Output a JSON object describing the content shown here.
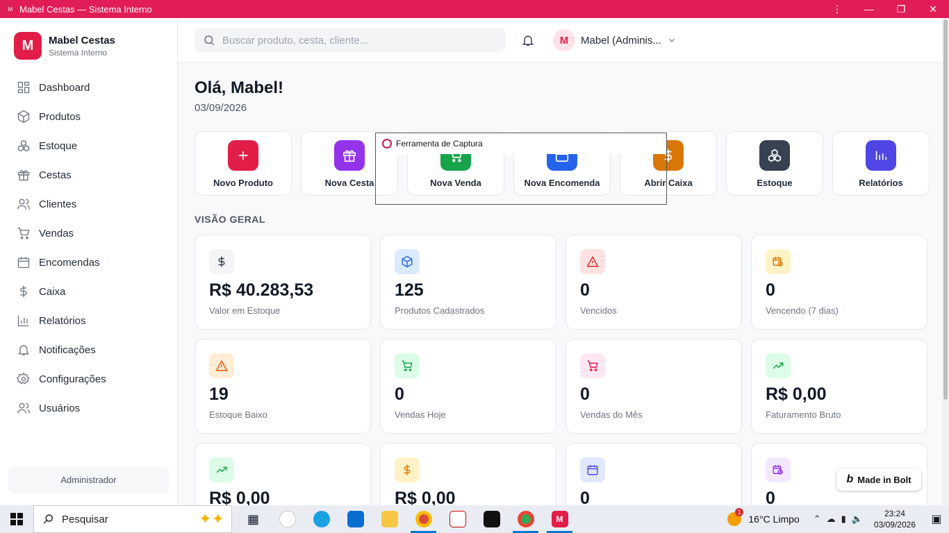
{
  "window": {
    "title": "Mabel Cestas — Sistema Interno",
    "app_icon_text": "M"
  },
  "brand": {
    "logo_letter": "M",
    "name": "Mabel Cestas",
    "subtitle": "Sistema Interno"
  },
  "sidebar": {
    "items": [
      {
        "label": "Dashboard",
        "icon": "grid-icon"
      },
      {
        "label": "Produtos",
        "icon": "box-icon"
      },
      {
        "label": "Estoque",
        "icon": "boxes-icon"
      },
      {
        "label": "Cestas",
        "icon": "gift-icon"
      },
      {
        "label": "Clientes",
        "icon": "users-icon"
      },
      {
        "label": "Vendas",
        "icon": "cart-icon"
      },
      {
        "label": "Encomendas",
        "icon": "calendar-icon"
      },
      {
        "label": "Caixa",
        "icon": "dollar-icon"
      },
      {
        "label": "Relatórios",
        "icon": "bar-chart-icon"
      },
      {
        "label": "Notificações",
        "icon": "bell-icon"
      },
      {
        "label": "Configurações",
        "icon": "gear-icon"
      },
      {
        "label": "Usuários",
        "icon": "user-group-icon"
      }
    ],
    "role": "Administrador"
  },
  "header": {
    "search_placeholder": "Buscar produto, cesta, cliente...",
    "user_initial": "M",
    "user_name": "Mabel (Adminis..."
  },
  "main": {
    "greeting": "Olá, Mabel!",
    "date": "03/09/2026",
    "quick_actions": [
      {
        "label": "Novo Produto",
        "color": "#e11d48",
        "icon": "plus-icon"
      },
      {
        "label": "Nova Cesta",
        "color": "#9333ea",
        "icon": "gift-icon"
      },
      {
        "label": "Nova Venda",
        "color": "#16a34a",
        "icon": "cart-icon"
      },
      {
        "label": "Nova Encomenda",
        "color": "#2563eb",
        "icon": "calendar-icon"
      },
      {
        "label": "Abrir Caixa",
        "color": "#d97706",
        "icon": "dollar-icon"
      },
      {
        "label": "Estoque",
        "color": "#374151",
        "icon": "boxes-icon"
      },
      {
        "label": "Relatórios",
        "color": "#4f46e5",
        "icon": "bar-chart-icon"
      }
    ],
    "section_title": "VISÃO GERAL",
    "stats": [
      {
        "value": "R$ 40.283,53",
        "label": "Valor em Estoque",
        "icon": "dollar-icon",
        "bg": "#f3f4f6",
        "fg": "#374151"
      },
      {
        "value": "125",
        "label": "Produtos Cadastrados",
        "icon": "box-icon",
        "bg": "#dbeafe",
        "fg": "#2563eb"
      },
      {
        "value": "0",
        "label": "Vencidos",
        "icon": "alert-icon",
        "bg": "#fee2e2",
        "fg": "#dc2626"
      },
      {
        "value": "0",
        "label": "Vencendo (7 dias)",
        "icon": "calendar-clock-icon",
        "bg": "#fef3c7",
        "fg": "#d97706"
      },
      {
        "value": "19",
        "label": "Estoque Baixo",
        "icon": "alert-icon",
        "bg": "#ffedd5",
        "fg": "#ea580c"
      },
      {
        "value": "0",
        "label": "Vendas Hoje",
        "icon": "cart-icon",
        "bg": "#dcfce7",
        "fg": "#16a34a"
      },
      {
        "value": "0",
        "label": "Vendas do Mês",
        "icon": "cart-icon",
        "bg": "#fce7f3",
        "fg": "#e11d48"
      },
      {
        "value": "R$ 0,00",
        "label": "Faturamento Bruto",
        "icon": "trend-up-icon",
        "bg": "#dcfce7",
        "fg": "#16a34a"
      },
      {
        "value": "R$ 0,00",
        "label": "",
        "icon": "trend-up-icon",
        "bg": "#dcfce7",
        "fg": "#16a34a"
      },
      {
        "value": "R$ 0,00",
        "label": "",
        "icon": "dollar-icon",
        "bg": "#fef3c7",
        "fg": "#d97706"
      },
      {
        "value": "0",
        "label": "",
        "icon": "calendar-icon",
        "bg": "#e0e7ff",
        "fg": "#4f46e5"
      },
      {
        "value": "0",
        "label": "",
        "icon": "calendar-clock-icon",
        "bg": "#f3e8ff",
        "fg": "#9333ea"
      }
    ]
  },
  "bolt_badge": "Made in Bolt",
  "snipping_tool": {
    "title": "Ferramenta de Captura"
  },
  "taskbar": {
    "search_label": "Pesquisar",
    "weather": "16°C  Limpo",
    "time": "23:24",
    "date": "03/09/2026"
  }
}
